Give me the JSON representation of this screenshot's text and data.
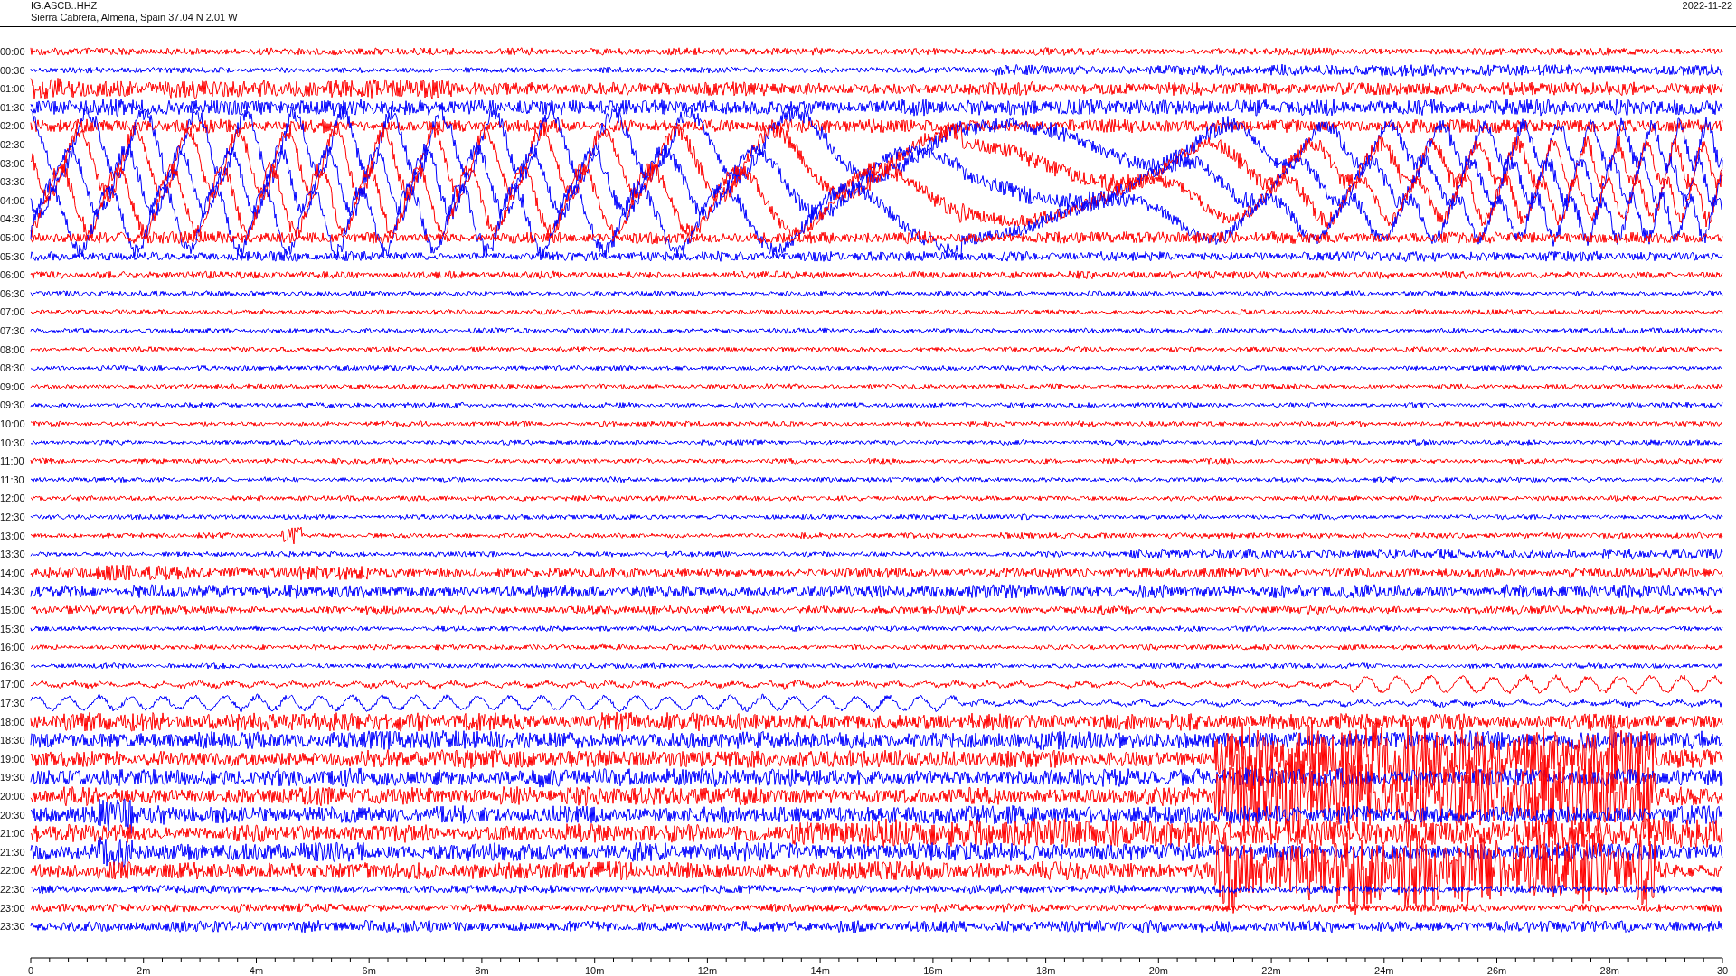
{
  "header": {
    "station": "IG.ASCB..HHZ",
    "location": "Sierra Cabrera, Almeria, Spain  37.04 N 2.01 W",
    "date": "2022-11-22"
  },
  "rows": [
    {
      "time": "00:00",
      "color": "#ff0000"
    },
    {
      "time": "00:30",
      "color": "#0000ff"
    },
    {
      "time": "01:00",
      "color": "#ff0000"
    },
    {
      "time": "01:30",
      "color": "#0000ff"
    },
    {
      "time": "02:00",
      "color": "#ff0000"
    },
    {
      "time": "02:30",
      "color": "#0000ff"
    },
    {
      "time": "03:00",
      "color": "#ff0000"
    },
    {
      "time": "03:30",
      "color": "#0000ff"
    },
    {
      "time": "04:00",
      "color": "#ff0000"
    },
    {
      "time": "04:30",
      "color": "#0000ff"
    },
    {
      "time": "05:00",
      "color": "#ff0000"
    },
    {
      "time": "05:30",
      "color": "#0000ff"
    },
    {
      "time": "06:00",
      "color": "#ff0000"
    },
    {
      "time": "06:30",
      "color": "#0000ff"
    },
    {
      "time": "07:00",
      "color": "#ff0000"
    },
    {
      "time": "07:30",
      "color": "#0000ff"
    },
    {
      "time": "08:00",
      "color": "#ff0000"
    },
    {
      "time": "08:30",
      "color": "#0000ff"
    },
    {
      "time": "09:00",
      "color": "#ff0000"
    },
    {
      "time": "09:30",
      "color": "#0000ff"
    },
    {
      "time": "10:00",
      "color": "#ff0000"
    },
    {
      "time": "10:30",
      "color": "#0000ff"
    },
    {
      "time": "11:00",
      "color": "#ff0000"
    },
    {
      "time": "11:30",
      "color": "#0000ff"
    },
    {
      "time": "12:00",
      "color": "#ff0000"
    },
    {
      "time": "12:30",
      "color": "#0000ff"
    },
    {
      "time": "13:00",
      "color": "#ff0000"
    },
    {
      "time": "13:30",
      "color": "#0000ff"
    },
    {
      "time": "14:00",
      "color": "#ff0000"
    },
    {
      "time": "14:30",
      "color": "#0000ff"
    },
    {
      "time": "15:00",
      "color": "#ff0000"
    },
    {
      "time": "15:30",
      "color": "#0000ff"
    },
    {
      "time": "16:00",
      "color": "#ff0000"
    },
    {
      "time": "16:30",
      "color": "#0000ff"
    },
    {
      "time": "17:00",
      "color": "#ff0000"
    },
    {
      "time": "17:30",
      "color": "#0000ff"
    },
    {
      "time": "18:00",
      "color": "#ff0000"
    },
    {
      "time": "18:30",
      "color": "#0000ff"
    },
    {
      "time": "19:00",
      "color": "#ff0000"
    },
    {
      "time": "19:30",
      "color": "#0000ff"
    },
    {
      "time": "20:00",
      "color": "#ff0000"
    },
    {
      "time": "20:30",
      "color": "#0000ff"
    },
    {
      "time": "21:00",
      "color": "#ff0000"
    },
    {
      "time": "21:30",
      "color": "#0000ff"
    },
    {
      "time": "22:00",
      "color": "#ff0000"
    },
    {
      "time": "22:30",
      "color": "#0000ff"
    },
    {
      "time": "23:00",
      "color": "#ff0000"
    },
    {
      "time": "23:30",
      "color": "#0000ff"
    }
  ],
  "axis": {
    "labels": [
      "0",
      "2m",
      "4m",
      "6m",
      "8m",
      "10m",
      "12m",
      "14m",
      "16m",
      "18m",
      "20m",
      "22m",
      "24m",
      "26m",
      "28m",
      "30"
    ]
  }
}
